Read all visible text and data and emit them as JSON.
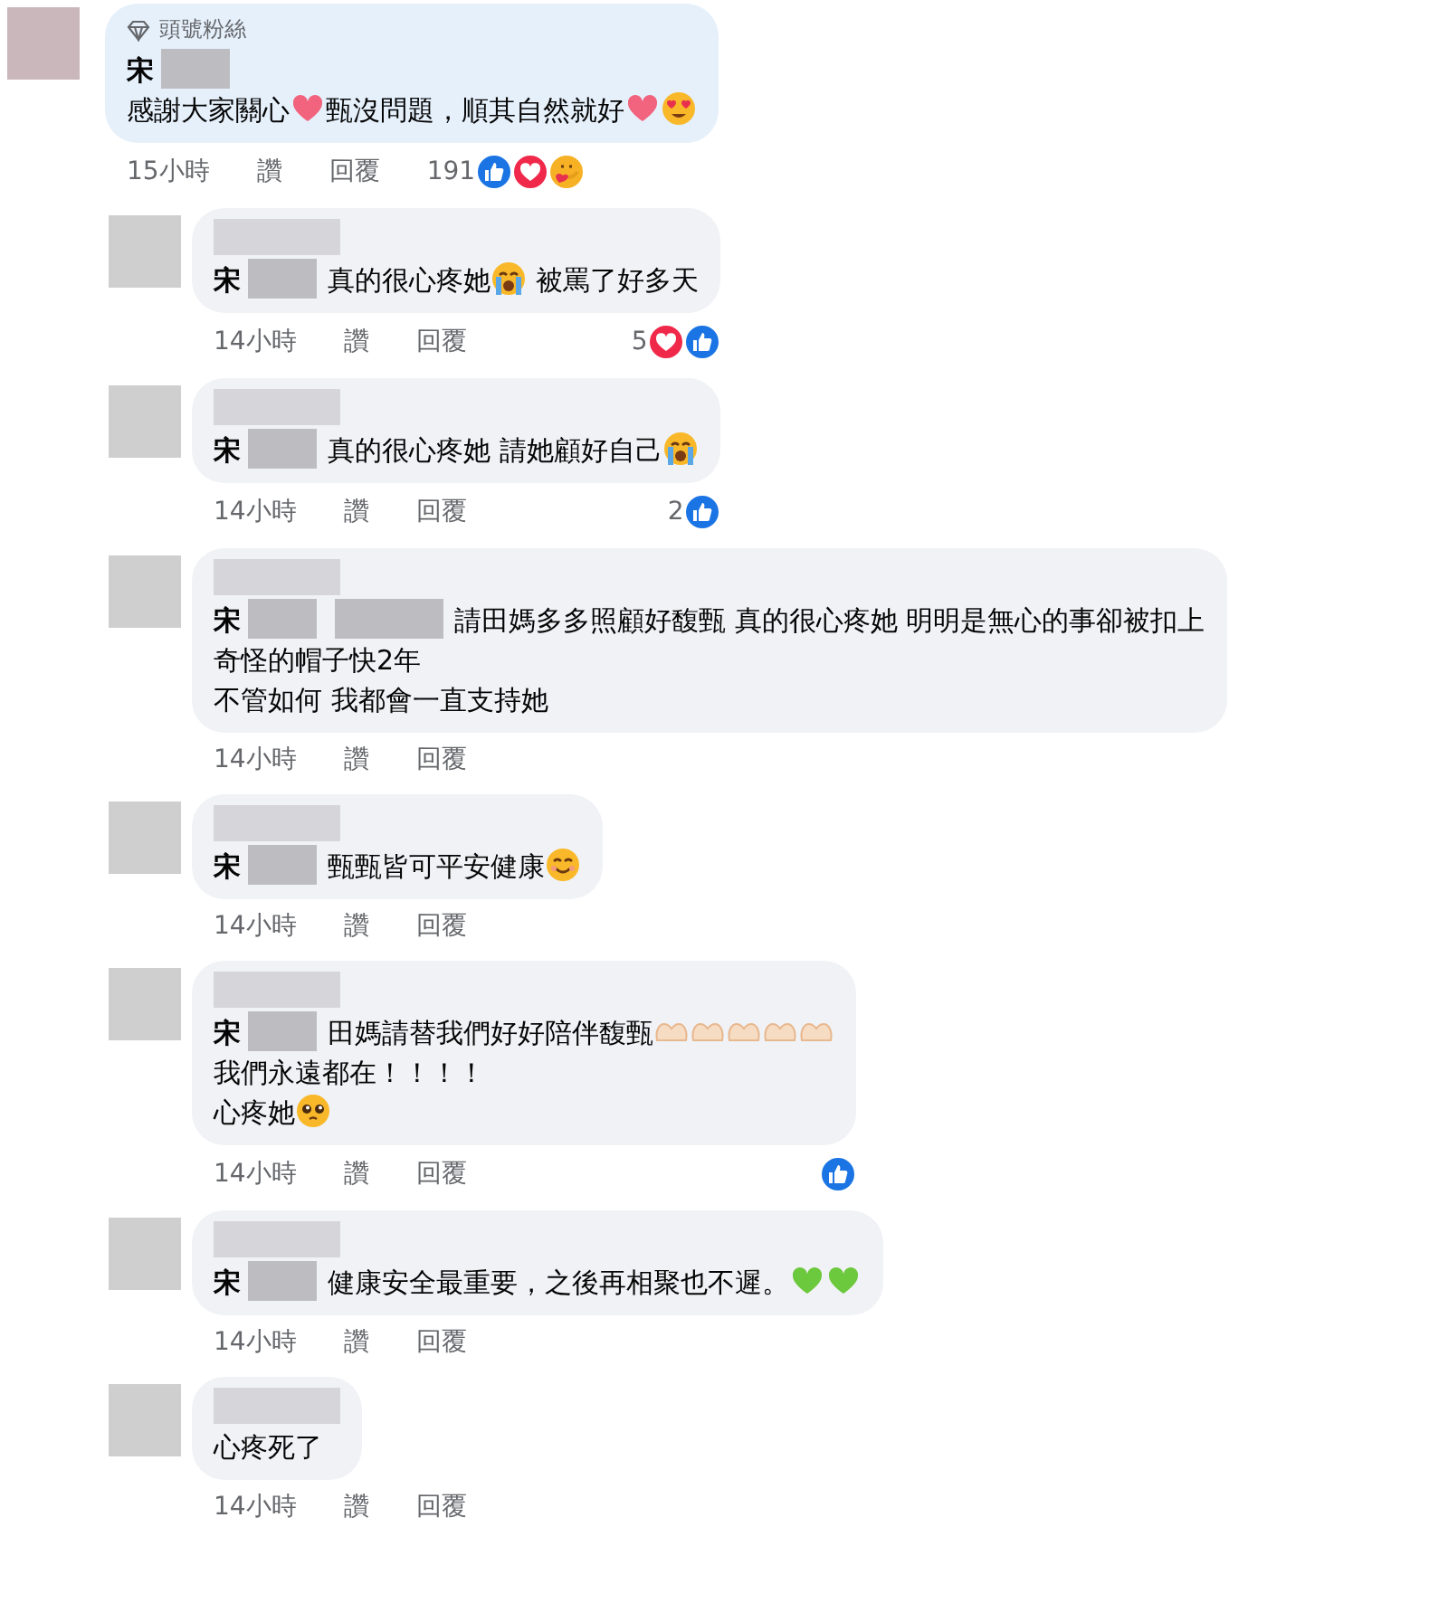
{
  "comments": [
    {
      "kind": "top",
      "badge": "頭號粉絲",
      "author": "宋",
      "body": [
        {
          "kind": "break"
        },
        {
          "kind": "text",
          "text": "感謝大家關心"
        },
        {
          "kind": "heart"
        },
        {
          "kind": "text",
          "text": "甄沒問題，順其自然就好"
        },
        {
          "kind": "heart"
        },
        {
          "kind": "heart-eyes"
        }
      ],
      "time": "15小時",
      "like": "讚",
      "reply": "回覆",
      "reactions": {
        "count": "191",
        "items": [
          {
            "kind": "like"
          },
          {
            "kind": "love"
          },
          {
            "kind": "care"
          }
        ]
      }
    },
    {
      "kind": "reply",
      "author": "宋",
      "body": [
        {
          "kind": "text",
          "text": "真的很心疼她"
        },
        {
          "kind": "crying"
        },
        {
          "kind": "text",
          "text": " 被罵了好多天"
        }
      ],
      "time": "14小時",
      "like": "讚",
      "reply": "回覆",
      "reactions": {
        "count": "5",
        "items": [
          {
            "kind": "love"
          },
          {
            "kind": "like"
          }
        ]
      }
    },
    {
      "kind": "reply",
      "author": "宋",
      "body": [
        {
          "kind": "text",
          "text": "真的很心疼她 請她顧好自己"
        },
        {
          "kind": "crying"
        }
      ],
      "time": "14小時",
      "like": "讚",
      "reply": "回覆",
      "reactions": {
        "count": "2",
        "items": [
          {
            "kind": "like"
          }
        ]
      }
    },
    {
      "kind": "reply",
      "author": "宋",
      "second_redaction": true,
      "body": [
        {
          "kind": "text",
          "text": "請田媽多多照顧好馥甄 真的很心疼她 明明是無心的事卻被扣上"
        },
        {
          "kind": "break"
        },
        {
          "kind": "text",
          "text": "奇怪的帽子快2年"
        },
        {
          "kind": "break"
        },
        {
          "kind": "text",
          "text": "不管如何 我都會一直支持她"
        }
      ],
      "time": "14小時",
      "like": "讚",
      "reply": "回覆"
    },
    {
      "kind": "reply",
      "author": "宋",
      "body": [
        {
          "kind": "text",
          "text": "甄甄皆可平安健康"
        },
        {
          "kind": "smile"
        }
      ],
      "time": "14小時",
      "like": "讚",
      "reply": "回覆"
    },
    {
      "kind": "reply",
      "author": "宋",
      "body": [
        {
          "kind": "text",
          "text": "田媽請替我們好好陪伴馥甄"
        },
        {
          "kind": "hands"
        },
        {
          "kind": "hands"
        },
        {
          "kind": "hands"
        },
        {
          "kind": "hands"
        },
        {
          "kind": "hands"
        },
        {
          "kind": "break"
        },
        {
          "kind": "text",
          "text": "我們永遠都在！！！！"
        },
        {
          "kind": "break"
        },
        {
          "kind": "text",
          "text": "心疼她"
        },
        {
          "kind": "pleading"
        }
      ],
      "time": "14小時",
      "like": "讚",
      "reply": "回覆",
      "reactions": {
        "items": [
          {
            "kind": "like"
          }
        ]
      }
    },
    {
      "kind": "reply",
      "author": "宋",
      "body": [
        {
          "kind": "text",
          "text": "健康安全最重要，之後再相聚也不遲。"
        },
        {
          "kind": "green-heart"
        },
        {
          "kind": "green-heart"
        }
      ],
      "time": "14小時",
      "like": "讚",
      "reply": "回覆"
    },
    {
      "kind": "reply",
      "body": [
        {
          "kind": "text",
          "text": "心疼死了"
        }
      ],
      "time": "14小時",
      "like": "讚",
      "reply": "回覆"
    }
  ]
}
